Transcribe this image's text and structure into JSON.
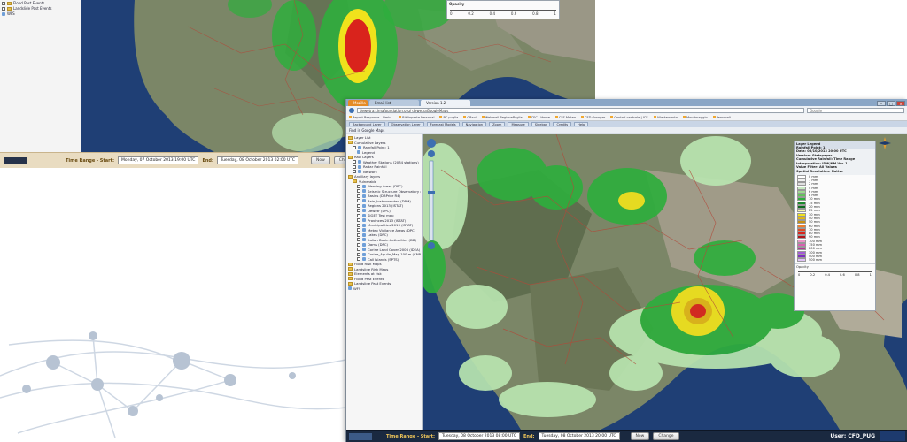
{
  "colors": {
    "sea": "#1f3f75",
    "land": "#7f8a6a",
    "rain_green": "#2fae3d",
    "rain_yellow": "#f0e21c",
    "rain_red": "#d9231c",
    "timebar": "#e9dcc1"
  },
  "back_window": {
    "sidebar_items": [
      "Flood Past Events",
      "Landslide Past Events",
      "WFS"
    ],
    "opacity_label": "Opacity",
    "opacity_ticks": [
      "0",
      "0.2",
      "0.4",
      "0.6",
      "0.8",
      "1"
    ],
    "timebar": {
      "label": "Time Range - Start:",
      "start": "Monday, 07 October 2013 19:00 UTC",
      "end_label": "End:",
      "end": "Tuesday, 08 October 2013 02:00 UTC",
      "now_button": "Now",
      "change_button": "Change"
    }
  },
  "front_window": {
    "tabs": [
      {
        "label": "Mozilla",
        "icon": "firefox-icon"
      },
      {
        "label": "Email list",
        "icon": "mail-icon"
      },
      {
        "label": "Version 1.2",
        "icon": "page-icon"
      }
    ],
    "url": "dewetra.cimafoundation.org/ dewetraGoogleMaps",
    "search_placeholder": "Google",
    "bookmarks": [
      "Report Response - Limb...",
      "Bibliopeste Personal",
      "PC puglia",
      "GRsol",
      "Webmail RegionePuglia",
      "CFC | Home",
      "CFS Meteo",
      "CFD Omoges",
      "Control centrale | ICE",
      "Allertamento",
      "Monitoraggio",
      "Personali"
    ],
    "app_menus": [
      "Background Layer",
      "Observation Layer",
      "Forecast Models",
      "Navigation",
      "Zoom",
      "Measure",
      "Sidebar",
      "Credits",
      "Help"
    ],
    "subbar_label": "Find in Google Maps",
    "sidebar_items": [
      {
        "label": "Layer List",
        "indent": 0,
        "type": "folder"
      },
      {
        "label": "Cumulative Layers",
        "indent": 0,
        "type": "folder"
      },
      {
        "label": "Rainfall Point: 1",
        "indent": 1,
        "type": "check"
      },
      {
        "label": "Legend",
        "indent": 2,
        "type": "leaf"
      },
      {
        "label": "Raw Layers",
        "indent": 0,
        "type": "folder"
      },
      {
        "label": "Weather Stations (2034 stations)",
        "indent": 1,
        "type": "check"
      },
      {
        "label": "Radar Rainfall",
        "indent": 1,
        "type": "check"
      },
      {
        "label": "Network",
        "indent": 1,
        "type": "check"
      },
      {
        "label": "Ancillary layers",
        "indent": 0,
        "type": "folder"
      },
      {
        "label": "Vulnerable",
        "indent": 1,
        "type": "folder"
      },
      {
        "label": "Warning Areas (DPC)",
        "indent": 2,
        "type": "check"
      },
      {
        "label": "Seismic Structure Observatory (DPC)",
        "indent": 2,
        "type": "check"
      },
      {
        "label": "Basins (DBPrior R4)",
        "indent": 2,
        "type": "check"
      },
      {
        "label": "Rain_Instrumented (DBM)",
        "indent": 2,
        "type": "check"
      },
      {
        "label": "Regions 2013 (ISTAT)",
        "indent": 2,
        "type": "check"
      },
      {
        "label": "Dewetr (DPC)",
        "indent": 2,
        "type": "check"
      },
      {
        "label": "SIGET Test map",
        "indent": 2,
        "type": "check"
      },
      {
        "label": "Provinces 2013 (ISTAT)",
        "indent": 2,
        "type": "check"
      },
      {
        "label": "Municipalities 2013 (ISTAT)",
        "indent": 2,
        "type": "check"
      },
      {
        "label": "Meteo Vigilance Areas (DPC)",
        "indent": 2,
        "type": "check"
      },
      {
        "label": "Lakes (DPC)",
        "indent": 2,
        "type": "check"
      },
      {
        "label": "Italian Basin Authorities (DB)",
        "indent": 2,
        "type": "check"
      },
      {
        "label": "Dams (DPC)",
        "indent": 2,
        "type": "check"
      },
      {
        "label": "Corine Land Cover 2006 (IDEA)",
        "indent": 2,
        "type": "check"
      },
      {
        "label": "Corine_Apulia_Map 100 m (CNR)",
        "indent": 2,
        "type": "check"
      },
      {
        "label": "Call Islands (SPTS)",
        "indent": 2,
        "type": "check"
      },
      {
        "label": "Flood Risk Maps",
        "indent": 0,
        "type": "folder"
      },
      {
        "label": "Landslide Risk Maps",
        "indent": 0,
        "type": "folder"
      },
      {
        "label": "Elements at risk",
        "indent": 0,
        "type": "folder"
      },
      {
        "label": "Flood Past Events",
        "indent": 0,
        "type": "folder"
      },
      {
        "label": "Landslide Past Events",
        "indent": 0,
        "type": "folder"
      },
      {
        "label": "WFS",
        "indent": 0,
        "type": "leaf"
      }
    ],
    "legend": {
      "title": "Layer Legend",
      "subtitle": "Rainfall Point: 1",
      "info": [
        "Data: 08/10/2013 20:00 UTC",
        "Version: Statspaper",
        "Cumulative Rainfall: Time Range",
        "Interpolation: IDW/KM Ver. 1",
        "Vaiue Filter: All Values",
        "Spatial Resolution: Native"
      ],
      "rows": [
        {
          "label": "0 mm",
          "color": "#ffffff"
        },
        {
          "label": "1 mm",
          "color": "#f2f2f2"
        },
        {
          "label": "2 mm",
          "color": "#e0e0e0"
        },
        {
          "label": "4 mm",
          "color": "#c8eac2"
        },
        {
          "label": "6 mm",
          "color": "#9ed992"
        },
        {
          "label": "8 mm",
          "color": "#63c15b"
        },
        {
          "label": "10 mm",
          "color": "#2fae3d"
        },
        {
          "label": "15 mm",
          "color": "#1a8a2c"
        },
        {
          "label": "20 mm",
          "color": "#0d6b1f"
        },
        {
          "label": "25 mm",
          "color": "#f8f6a6"
        },
        {
          "label": "30 mm",
          "color": "#f0e21c"
        },
        {
          "label": "40 mm",
          "color": "#e0b516"
        },
        {
          "label": "50 mm",
          "color": "#c69013"
        },
        {
          "label": "60 mm",
          "color": "#ee7d2a"
        },
        {
          "label": "70 mm",
          "color": "#e14b24"
        },
        {
          "label": "80 mm",
          "color": "#d9231c"
        },
        {
          "label": "90 mm",
          "color": "#b3141a"
        },
        {
          "label": "100 mm",
          "color": "#ea96c8"
        },
        {
          "label": "150 mm",
          "color": "#d860b1"
        },
        {
          "label": "200 mm",
          "color": "#b33596"
        },
        {
          "label": "300 mm",
          "color": "#a55bd6"
        },
        {
          "label": "400 mm",
          "color": "#7d2fc1"
        },
        {
          "label": "500 mm",
          "color": "#e0c3f6"
        }
      ],
      "opacity_label": "Opacity",
      "opacity_ticks": [
        "0",
        "0.2",
        "0.4",
        "0.6",
        "0.8",
        "1"
      ]
    },
    "timebar": {
      "label": "Time Range - Start:",
      "start": "Tuesday, 08 October 2013 08:00 UTC",
      "end_label": "End:",
      "end": "Tuesday, 08 October 2013 20:00 UTC",
      "now_button": "Now",
      "change_button": "Change"
    },
    "user_label": "User: CFD_PUG"
  }
}
